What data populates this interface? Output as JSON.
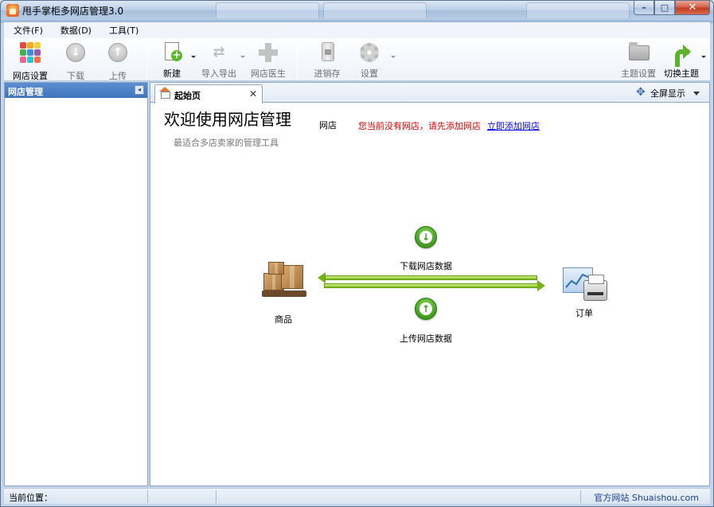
{
  "window": {
    "title": "甩手掌柜多网店管理3.0"
  },
  "menu": {
    "items": [
      "文件(F)",
      "数据(D)",
      "工具(T)"
    ]
  },
  "toolbar": {
    "shop_settings": "网店设置",
    "download": "下载",
    "upload": "上传",
    "new": "新建",
    "import_export": "导入导出",
    "shop_doctor": "网店医生",
    "inventory": "进销存",
    "settings": "设置",
    "theme_settings": "主题设置",
    "switch_theme": "切换主题"
  },
  "left_panel": {
    "title": "网店管理"
  },
  "tabs": {
    "start_page": "起始页",
    "fullscreen": "全屏显示"
  },
  "welcome": {
    "title": "欢迎使用网店管理",
    "shop_label": "网店",
    "warning": "您当前没有网店，请先添加网店",
    "add_link": "立即添加网店",
    "subtitle": "最适合多店卖家的管理工具"
  },
  "diagram": {
    "goods_label": "商品",
    "order_label": "订单",
    "download_label": "下载网店数据",
    "upload_label": "上传网店数据"
  },
  "statusbar": {
    "location_label": "当前位置：",
    "site_link": "官方网站 Shuaishou.com"
  },
  "colors": {
    "warning_text": "#e00000",
    "link_text": "#0000ee",
    "accent_green": "#3e9a1c",
    "panel_header": "#3e72bb"
  }
}
